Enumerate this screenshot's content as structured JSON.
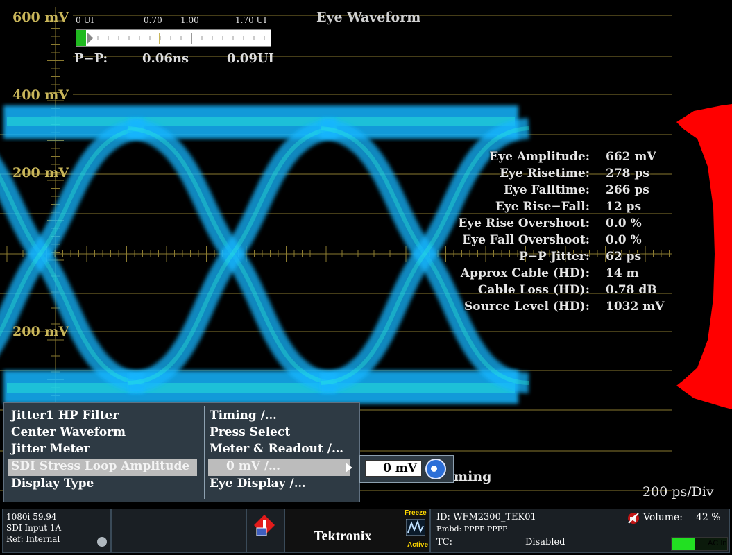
{
  "display": {
    "title": "Eye Waveform",
    "axis_labels": [
      "600 mV",
      "400 mV",
      "200 mV",
      "200 mV"
    ],
    "scale": "200 ps/Div"
  },
  "jitter_meter": {
    "ticks": [
      "0 UI",
      "0.70",
      "1.00",
      "1.70 UI"
    ],
    "level_fraction": 0.05,
    "pp_label": "P−P:",
    "pp_ns": "0.06ns",
    "pp_ui": "0.09UI"
  },
  "readouts": [
    {
      "label": "Eye Amplitude:",
      "value": "662 mV"
    },
    {
      "label": "Eye Risetime:",
      "value": "278 ps"
    },
    {
      "label": "Eye Falltime:",
      "value": "266 ps"
    },
    {
      "label": "Eye Rise−Fall:",
      "value": "12 ps"
    },
    {
      "label": "Eye Rise Overshoot:",
      "value": "0.0 %"
    },
    {
      "label": "Eye Fall Overshoot:",
      "value": "0.0 %"
    },
    {
      "label": "P−P Jitter:",
      "value": "62 ps"
    },
    {
      "label": "Approx Cable (HD):",
      "value": "14 m"
    },
    {
      "label": "Cable Loss (HD):",
      "value": "0.78 dB"
    },
    {
      "label": "Source Level (HD):",
      "value": "1032 mV"
    }
  ],
  "menu": {
    "items": [
      {
        "label": "Jitter1 HP Filter",
        "value": "Timing /…"
      },
      {
        "label": "Center Waveform",
        "value": "Press Select"
      },
      {
        "label": "Jitter Meter",
        "value": "Meter & Readout /…"
      },
      {
        "label": "SDI Stress Loop Amplitude",
        "value": "0 mV /…"
      },
      {
        "label": "Display Type",
        "value": "Eye Display /…"
      }
    ],
    "selected_index": 3,
    "edit_value": "0 mV",
    "behind_text": "ming"
  },
  "status": {
    "format": "1080i 59.94",
    "input": "SDI Input 1A",
    "ref": "Ref: Internal",
    "brand": "Tektronix",
    "freeze": "Freeze",
    "active": "Active",
    "id": "ID: WFM2300_TEK01",
    "embd": "Embd: PPPP PPPP −−−− −−−−",
    "tc_label": "TC:",
    "tc_value": "Disabled",
    "volume_label": "Volume:",
    "volume_value": "42 %",
    "ac_label": "AC In",
    "volume_level": 0.42
  },
  "colors": {
    "eye": "#19b6ff",
    "eye_core": "#2cf0d8",
    "graticule": "#8a7a30",
    "histogram": "#ff0000",
    "meter_fill": "#1fb91f"
  }
}
